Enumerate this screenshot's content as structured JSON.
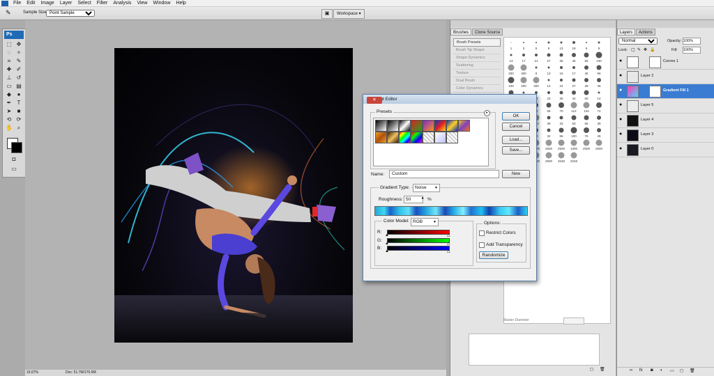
{
  "menubar": {
    "items": [
      "File",
      "Edit",
      "Image",
      "Layer",
      "Select",
      "Filter",
      "Analysis",
      "View",
      "Window",
      "Help"
    ]
  },
  "options": {
    "sample_size_label": "Sample Size:",
    "sample_size_value": "Point Sample",
    "workspace_label": "Workspace ▾",
    "eyedropper_icon": "eyedropper-icon"
  },
  "toolbox": {
    "logo": "Ps"
  },
  "status": {
    "zoom": "16.67%",
    "doc": "Doc: 51.7M/170.9M"
  },
  "brushes": {
    "tabs": [
      "Brushes",
      "Clone Source"
    ],
    "options": [
      "Brush Presets",
      "Brush Tip Shape",
      "Shape Dynamics",
      "Scattering",
      "Texture",
      "Dual Brush",
      "Color Dynamics"
    ],
    "master_diameter_label": "Master Diameter",
    "sizes": [
      "1",
      "3",
      "5",
      "9",
      "13",
      "19",
      "5",
      "9",
      "13",
      "17",
      "21",
      "27",
      "35",
      "45",
      "65",
      "100",
      "200",
      "300",
      "9",
      "13",
      "19",
      "17",
      "45",
      "65",
      "100",
      "200",
      "300",
      "14",
      "24",
      "27",
      "39",
      "46",
      "59",
      "11",
      "17",
      "23",
      "36",
      "44",
      "60",
      "14",
      "26",
      "33",
      "42",
      "55",
      "70",
      "112",
      "134",
      "74",
      "95",
      "29",
      "192",
      "36",
      "33",
      "63",
      "66",
      "39",
      "63",
      "11",
      "48",
      "32",
      "55",
      "100",
      "75",
      "45",
      "1106",
      "1300",
      "2500",
      "2500",
      "2500",
      "1300",
      "2500",
      "2500",
      "2500",
      "2500",
      "2500",
      "2500",
      "2048",
      "2048"
    ]
  },
  "layers": {
    "tabs": [
      "Layers",
      "Actions"
    ],
    "blend_mode": "Normal",
    "opacity_label": "Opacity:",
    "opacity_value": "100%",
    "lock_label": "Lock:",
    "fill_label": "Fill:",
    "fill_value": "100%",
    "items": [
      {
        "name": "Curves 1",
        "selected": false
      },
      {
        "name": "Layer 2",
        "selected": false
      },
      {
        "name": "Gradient Fill 1",
        "selected": true
      },
      {
        "name": "Layer 5",
        "selected": false
      },
      {
        "name": "Layer 4",
        "selected": false
      },
      {
        "name": "Layer 3",
        "selected": false
      },
      {
        "name": "Layer 0",
        "selected": false
      }
    ]
  },
  "dialog": {
    "title": "Gradient Editor",
    "presets_label": "Presets",
    "ok": "OK",
    "reset": "Cancel",
    "load": "Load...",
    "save": "Save...",
    "name_label": "Name:",
    "name_value": "Custom",
    "new_button": "New",
    "gradient_type_label": "Gradient Type:",
    "gradient_type_value": "Noise",
    "roughness_label": "Roughness:",
    "roughness_value": "50",
    "roughness_unit": "%",
    "color_model_label": "Color Model:",
    "color_model_value": "RGB",
    "r": "R:",
    "g": "G:",
    "b": "B:",
    "options_label": "Options:",
    "restrict_colors": "Restrict Colors",
    "add_transparency": "Add Transparency",
    "randomize": "Randomize",
    "colors": {
      "accent": "#3c7fb1",
      "title_bar": "#c8d9ec"
    }
  }
}
